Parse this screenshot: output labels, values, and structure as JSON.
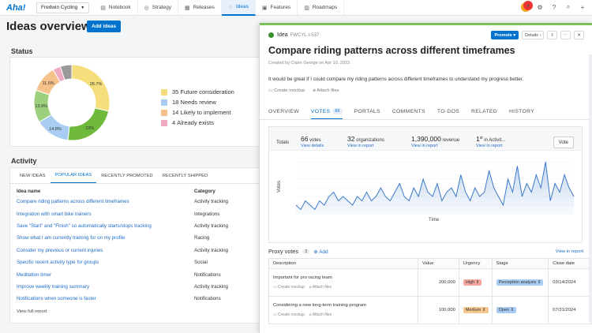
{
  "app": {
    "logo": "Aha!",
    "workspace": "Fredwin Cycling"
  },
  "nav": [
    {
      "label": "Notebook",
      "icon": "notebook-icon",
      "glyph": "▤"
    },
    {
      "label": "Strategy",
      "icon": "strategy-icon",
      "glyph": "◎"
    },
    {
      "label": "Releases",
      "icon": "releases-icon",
      "glyph": "▦"
    },
    {
      "label": "Ideas",
      "icon": "lightbulb-icon",
      "glyph": "♢"
    },
    {
      "label": "Features",
      "icon": "features-icon",
      "glyph": "▣"
    },
    {
      "label": "Roadmaps",
      "icon": "roadmaps-icon",
      "glyph": "▥"
    }
  ],
  "page": {
    "title": "Ideas overview",
    "add_button": "Add ideas"
  },
  "status": {
    "title": "Status",
    "legend": [
      {
        "count": "35",
        "label": "Future consideration",
        "color": "#f6de7d"
      },
      {
        "count": "18",
        "label": "Needs review",
        "color": "#a8cdf0"
      },
      {
        "count": "14",
        "label": "Likely to implement",
        "color": "#f6c28b"
      },
      {
        "count": "4",
        "label": "Already exists",
        "color": "#f0a9c3"
      }
    ],
    "donut": {
      "slices": [
        {
          "value": 28.7,
          "label": "28.7%",
          "color": "#f6de7d"
        },
        {
          "value": 23,
          "label": "23%",
          "color": "#6fba3c"
        },
        {
          "value": 14.8,
          "label": "14.8%",
          "color": "#a8cdf0"
        },
        {
          "value": 13.9,
          "label": "13.9%",
          "color": "#9ccf7e"
        },
        {
          "value": 11.5,
          "label": "11.5%",
          "color": "#f6c28b"
        },
        {
          "value": 3.3,
          "label": "",
          "color": "#f0a9c3"
        },
        {
          "value": 4.9,
          "label": "",
          "color": "#999999"
        }
      ]
    }
  },
  "activity": {
    "title": "Activity",
    "tabs": [
      "NEW IDEAS",
      "POPULAR IDEAS",
      "RECENTLY PROMOTED",
      "RECENTLY SHIPPED"
    ],
    "col_name": "Idea name",
    "col_cat": "Category",
    "rows": [
      {
        "name": "Compare riding patterns across different timeframes",
        "cat": "Activity tracking"
      },
      {
        "name": "Integration with smart bike trainers",
        "cat": "Integrations"
      },
      {
        "name": "Save \"Start\" and \"Finish\" so automatically starts/stops tracking",
        "cat": "Activity tracking"
      },
      {
        "name": "Show what I am currently training for on my profile",
        "cat": "Racing"
      },
      {
        "name": "Consider my previous or current injuries",
        "cat": "Activity tracking"
      },
      {
        "name": "Specific recent activity type for groups",
        "cat": "Social"
      },
      {
        "name": "Meditation timer",
        "cat": "Notifications"
      },
      {
        "name": "Improve weekly training summary",
        "cat": "Activity tracking"
      },
      {
        "name": "Notifications when someone is faster",
        "cat": "Notifications"
      }
    ],
    "view_full": "View full report"
  },
  "idea": {
    "type": "Idea",
    "ref": "FWCYL-I-537",
    "promote": "Promote",
    "details": "Details",
    "title": "Compare riding patterns across different timeframes",
    "meta": "Created by Claire George on Apr 10, 2023",
    "description": "It would be great if I could compare my riding patterns across different timeframes to understand my progress better.",
    "create_mockup": "Create mockup",
    "attach_files": "Attach files",
    "tabs": [
      "OVERVIEW",
      "VOTES",
      "PORTALS",
      "COMMENTS",
      "TO-DOS",
      "RELATED",
      "HISTORY"
    ],
    "votes_count": "66"
  },
  "votes": {
    "totals_label": "Totals",
    "stats": [
      {
        "value": "66",
        "unit": "votes",
        "link": "View details"
      },
      {
        "value": "32",
        "unit": "organizations",
        "link": "View in report"
      },
      {
        "value": "1,390,000",
        "unit": "revenue",
        "link": "View in report"
      },
      {
        "value": "1",
        "sup": "st",
        "unit": "in Activit...",
        "link": "View in report"
      }
    ],
    "vote_button": "Vote"
  },
  "chart_data": {
    "type": "area",
    "xlabel": "Time",
    "ylabel": "Votes",
    "values": [
      2,
      1,
      3,
      2,
      1,
      3,
      2,
      4,
      5,
      3,
      4,
      3,
      2,
      4,
      3,
      5,
      3,
      4,
      6,
      4,
      3,
      5,
      7,
      4,
      3,
      6,
      4,
      8,
      5,
      4,
      7,
      3,
      5,
      6,
      4,
      9,
      5,
      3,
      6,
      4,
      5,
      10,
      6,
      4,
      2,
      8,
      5,
      11,
      4,
      7,
      5,
      9,
      6,
      12,
      3,
      7,
      5,
      9,
      6,
      4
    ]
  },
  "proxy": {
    "title": "Proxy votes",
    "count": "3",
    "add": "Add",
    "view_report": "View in report",
    "columns": [
      "Description",
      "Value",
      "Urgency",
      "Stage",
      "Close date"
    ],
    "rows": [
      {
        "desc": "Important for pro racing team",
        "value": "200,000",
        "urgency": "High",
        "urgency_color": "#f4a8a0",
        "stage": "Perception analysis",
        "stage_color": "#a9cdf2",
        "date": "03/14/2024"
      },
      {
        "desc": "Considering a new long-term training program",
        "value": "100,000",
        "urgency": "Medium",
        "urgency_color": "#f6c98f",
        "stage": "Open",
        "stage_color": "#a9cdf2",
        "date": "07/31/2024"
      }
    ]
  }
}
